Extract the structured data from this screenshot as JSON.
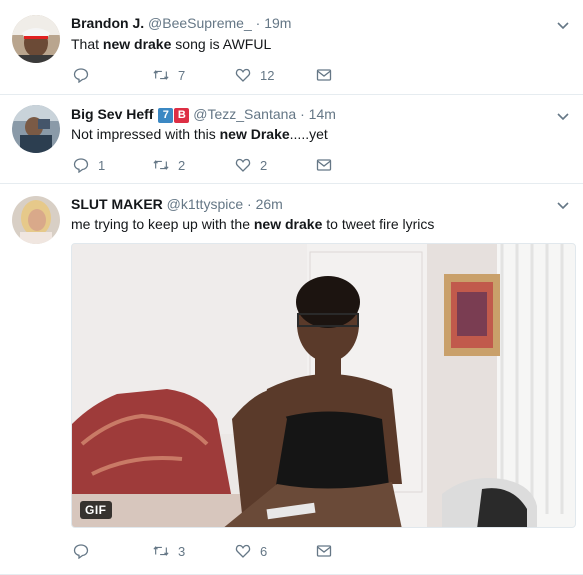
{
  "tweets": [
    {
      "name": "Brandon J.",
      "handle": "@BeeSupreme_",
      "sep": "·",
      "time": "19m",
      "text": {
        "pre": "That ",
        "bold": "new drake",
        "post": " song is AWFUL"
      },
      "reply_count": "",
      "retweet_count": "7",
      "like_count": "12"
    },
    {
      "name": "Big Sev Heff",
      "badges": [
        "7",
        "B"
      ],
      "badge_colors": [
        "#3b88c3",
        "#dd2e44"
      ],
      "handle": "@Tezz_Santana",
      "sep": "·",
      "time": "14m",
      "text": {
        "pre": "Not impressed with this ",
        "bold": "new Drake",
        "post": ".....yet"
      },
      "reply_count": "1",
      "retweet_count": "2",
      "like_count": "2"
    },
    {
      "name": "SLUT MAKER",
      "handle": "@k1ttyspice",
      "sep": "·",
      "time": "26m",
      "text": {
        "pre": "me trying to keep up with the ",
        "bold": "new drake",
        "post": " to tweet fire lyrics"
      },
      "media_badge": "GIF",
      "reply_count": "",
      "retweet_count": "3",
      "like_count": "6"
    }
  ],
  "colors": {
    "icon": "#657786",
    "text": "#14171a",
    "divider": "#e6ecf0"
  }
}
